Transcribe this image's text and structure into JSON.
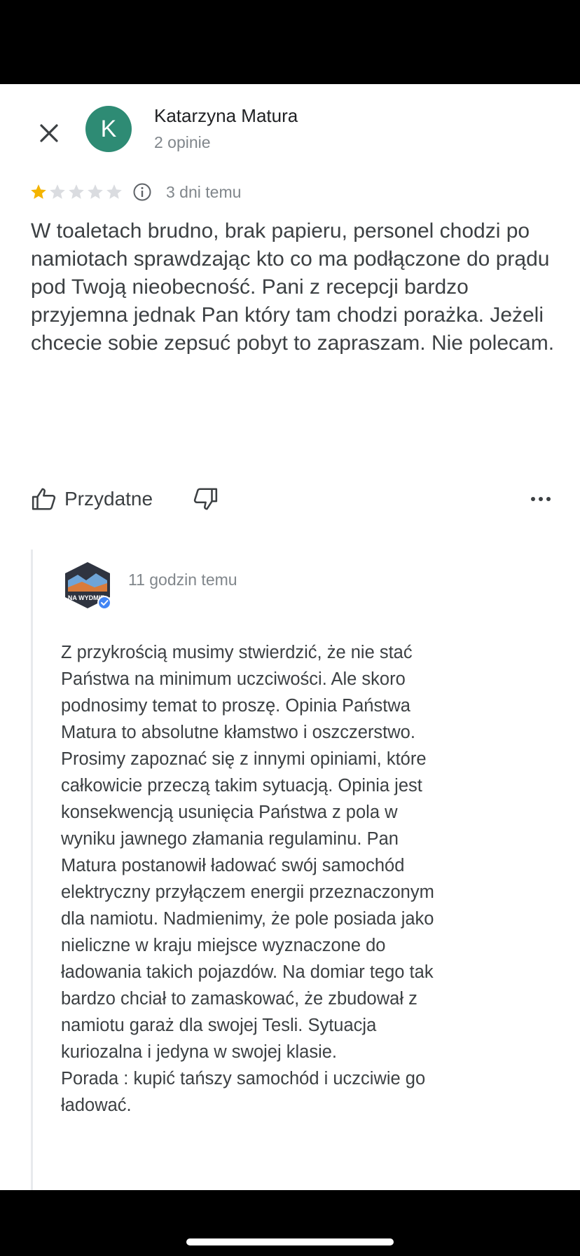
{
  "review": {
    "author_name": "Katarzyna Matura",
    "author_meta": "2 opinie",
    "avatar_letter": "K",
    "avatar_color": "#2e8b74",
    "rating": 1,
    "max_rating": 5,
    "time": "3 dni temu",
    "text": "W toaletach brudno, brak papieru, personel chodzi po namiotach sprawdzając kto co ma podłączone do prądu pod Twoją nieobecność. Pani z recepcji bardzo przyjemna jednak Pan który tam chodzi porażka. Jeżeli chcecie sobie zepsuć pobyt to zapraszam. Nie polecam."
  },
  "actions": {
    "helpful_label": "Przydatne"
  },
  "reply": {
    "time": "11 godzin temu",
    "logo_text": "NA WYDMIE",
    "text_lines": [
      "Z przykrością musimy stwierdzić, że nie stać",
      "Państwa na minimum uczciwości. Ale skoro",
      "podnosimy temat to proszę. Opinia Państwa",
      "Matura to absolutne kłamstwo i oszczerstwo.",
      "Prosimy zapoznać się z innymi opiniami, które",
      "całkowicie przeczą takim sytuacją. Opinia jest",
      "konsekwencją usunięcia Państwa z pola w",
      "wyniku jawnego złamania regulaminu. Pan",
      "Matura postanowił ładować swój samochód",
      "elektryczny przyłączem energii przeznaczonym",
      "dla namiotu. Nadmienimy, że pole posiada jako",
      "nieliczne w kraju miejsce wyznaczone do",
      "ładowania takich pojazdów. Na domiar tego tak",
      "bardzo chciał to zamaskować, że zbudował z",
      "namiotu garaż dla swojej Tesli. Sytuacja",
      "kuriozalna i jedyna w swojej klasie.",
      "Porada : kupić tańszy samochód i uczciwie go",
      "ładować."
    ]
  },
  "colors": {
    "star_filled": "#f4b400",
    "star_empty": "#dadce0",
    "verified": "#4285f4"
  },
  "icons": [
    "close-icon",
    "info-icon",
    "thumbs-up-icon",
    "thumbs-down-icon",
    "more-options-icon",
    "verified-badge-icon"
  ]
}
